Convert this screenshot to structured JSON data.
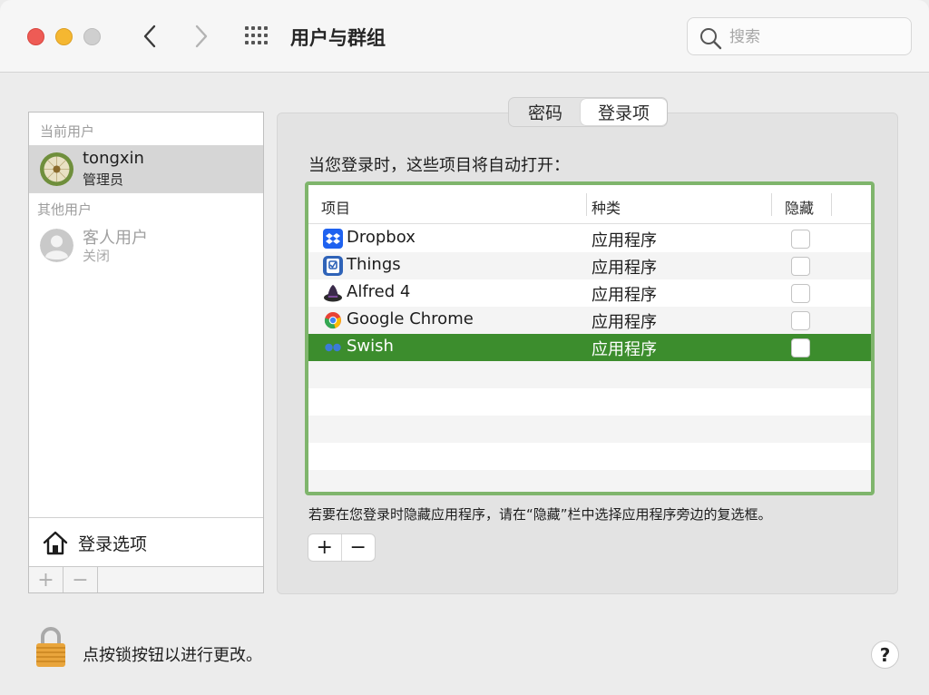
{
  "window": {
    "title": "用户与群组",
    "controls": {
      "close": "#ee5b55",
      "minimize": "#f5b731",
      "zoom": "#cfcfcf"
    }
  },
  "search": {
    "placeholder": "搜索",
    "value": ""
  },
  "users": {
    "current_label": "当前用户",
    "other_label": "其他用户",
    "current": {
      "name": "tongxin",
      "role": "管理员"
    },
    "guest": {
      "name": "客人用户",
      "status": "关闭"
    },
    "login_options_label": "登录选项",
    "add_label": "+",
    "remove_label": "−"
  },
  "tabs": [
    {
      "label": "密码",
      "selected": false
    },
    {
      "label": "登录项",
      "selected": true
    }
  ],
  "login_items": {
    "heading": "当您登录时，这些项目将自动打开：",
    "columns": {
      "item": "项目",
      "kind": "种类",
      "hide": "隐藏"
    },
    "rows": [
      {
        "name": "Dropbox",
        "kind": "应用程序",
        "hidden": false,
        "icon": "dropbox-icon"
      },
      {
        "name": "Things",
        "kind": "应用程序",
        "hidden": false,
        "icon": "things-icon"
      },
      {
        "name": "Alfred 4",
        "kind": "应用程序",
        "hidden": false,
        "icon": "alfred-icon"
      },
      {
        "name": "Google Chrome",
        "kind": "应用程序",
        "hidden": false,
        "icon": "chrome-icon"
      },
      {
        "name": "Swish",
        "kind": "应用程序",
        "hidden": false,
        "icon": "swish-icon",
        "selected": true
      }
    ],
    "hint": "若要在您登录时隐藏应用程序，请在“隐藏”栏中选择应用程序旁边的复选框。",
    "add_label": "+",
    "remove_label": "−",
    "highlight_color": "#7fb56c",
    "selection_color": "#3c8d2d"
  },
  "footer": {
    "lock_text": "点按锁按钮以进行更改。",
    "help_label": "?"
  }
}
